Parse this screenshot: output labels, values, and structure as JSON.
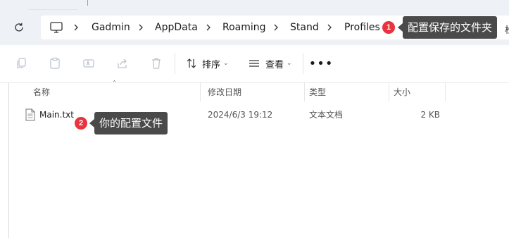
{
  "address": {
    "breadcrumbs": [
      "Gadmin",
      "AppData",
      "Roaming",
      "Stand",
      "Profiles"
    ],
    "overflow_char": "松"
  },
  "annotations": [
    {
      "number": "1",
      "text": "配置保存的文件夹"
    },
    {
      "number": "2",
      "text": "你的配置文件"
    }
  ],
  "toolbar": {
    "sort_label": "排序",
    "view_label": "查看",
    "more_label": "•••"
  },
  "columns": {
    "name": "名称",
    "modified": "修改日期",
    "type": "类型",
    "size": "大小"
  },
  "files": [
    {
      "name": "Main.txt",
      "modified": "2024/6/3 19:12",
      "type": "文本文档",
      "size": "2 KB"
    }
  ],
  "colors": {
    "address_bg": "#eef1f6",
    "badge": "#e9333d",
    "tooltip": "#4a4a4a"
  }
}
